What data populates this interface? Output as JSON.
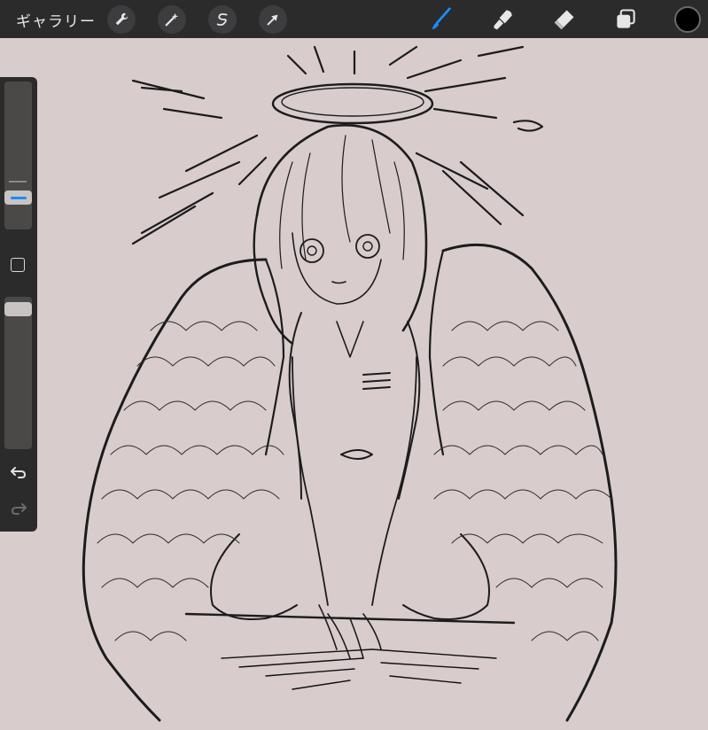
{
  "topbar": {
    "gallery_label": "ギャラリー",
    "left_tools": [
      "wrench-icon",
      "magic-wand-icon",
      "selection-icon",
      "transform-arrow-icon"
    ],
    "right_tools": [
      "brush-icon",
      "smudge-icon",
      "eraser-icon",
      "layers-icon"
    ],
    "active_tool": "brush",
    "active_color": "#000000",
    "accent_color": "#1a8cff"
  },
  "sidebar": {
    "items": [
      "brush-size-slider",
      "modify-button",
      "brush-opacity-slider",
      "undo-icon",
      "redo-icon"
    ],
    "brush_size_level": 0.79,
    "opacity_level": 1.0
  },
  "canvas": {
    "background_color": "#d8cccc",
    "subject": "pencil-sketch-angel-with-halo-and-wings"
  }
}
